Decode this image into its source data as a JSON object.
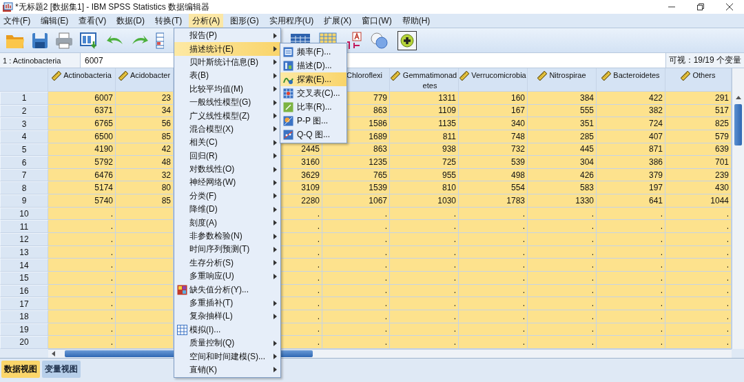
{
  "window": {
    "title": "*无标题2 [数据集1] - IBM SPSS Statistics 数据编辑器"
  },
  "menubar": [
    {
      "label": "文件(F)",
      "selected": false
    },
    {
      "label": "编辑(E)",
      "selected": false
    },
    {
      "label": "查看(V)",
      "selected": false
    },
    {
      "label": "数据(D)",
      "selected": false
    },
    {
      "label": "转换(T)",
      "selected": false
    },
    {
      "label": "分析(A)",
      "selected": true
    },
    {
      "label": "图形(G)",
      "selected": false
    },
    {
      "label": "实用程序(U)",
      "selected": false
    },
    {
      "label": "扩展(X)",
      "selected": false
    },
    {
      "label": "窗口(W)",
      "selected": false
    },
    {
      "label": "帮助(H)",
      "selected": false
    }
  ],
  "cell_editor": {
    "cell": "1 : Actinobacteria",
    "value": "6007",
    "visible_count": "可视：19/19 个变量"
  },
  "table": {
    "columns": [
      {
        "header": "Actinobacteria",
        "ruler": true
      },
      {
        "header": "Acidobacter",
        "ruler": true
      },
      null,
      {
        "header": "Chloroflexi"
      },
      {
        "header": "Gemmatimonadetes",
        "ruler": true
      },
      {
        "header": "Verrucomicrobia",
        "ruler": true
      },
      {
        "header": "Nitrospirae",
        "ruler": true
      },
      {
        "header": "Bacteroidetes",
        "ruler": true
      },
      {
        "header": "Others",
        "ruler": true
      }
    ],
    "rows": [
      {
        "number": "1",
        "cells": [
          "6007",
          "23",
          null,
          "779",
          "1311",
          "160",
          "384",
          "422",
          "291"
        ]
      },
      {
        "number": "2",
        "cells": [
          "6371",
          "34",
          null,
          "863",
          "1109",
          "167",
          "555",
          "382",
          "517"
        ]
      },
      {
        "number": "3",
        "cells": [
          "6765",
          "56",
          null,
          "1586",
          "1135",
          "340",
          "351",
          "724",
          "825"
        ]
      },
      {
        "number": "4",
        "cells": [
          "6500",
          "85",
          null,
          "1689",
          "811",
          "748",
          "285",
          "407",
          "579"
        ]
      },
      {
        "number": "5",
        "cells": [
          "4190",
          "42",
          "2445",
          "863",
          "938",
          "732",
          "445",
          "871",
          "639"
        ]
      },
      {
        "number": "6",
        "cells": [
          "5792",
          "48",
          "3160",
          "1235",
          "725",
          "539",
          "304",
          "386",
          "701"
        ]
      },
      {
        "number": "7",
        "cells": [
          "6476",
          "32",
          "3629",
          "765",
          "955",
          "498",
          "426",
          "379",
          "239"
        ]
      },
      {
        "number": "8",
        "cells": [
          "5174",
          "80",
          "3109",
          "1539",
          "810",
          "554",
          "583",
          "197",
          "430"
        ]
      },
      {
        "number": "9",
        "cells": [
          "5740",
          "85",
          "2280",
          "1067",
          "1030",
          "1783",
          "1330",
          "641",
          "1044"
        ]
      },
      {
        "number": "10",
        "cells": [
          ".",
          null,
          ".",
          ".",
          ".",
          ".",
          ".",
          ".",
          "."
        ]
      },
      {
        "number": "11",
        "cells": [
          ".",
          null,
          ".",
          ".",
          ".",
          ".",
          ".",
          ".",
          "."
        ]
      },
      {
        "number": "12",
        "cells": [
          ".",
          null,
          ".",
          ".",
          ".",
          ".",
          ".",
          ".",
          "."
        ]
      },
      {
        "number": "13",
        "cells": [
          ".",
          null,
          ".",
          ".",
          ".",
          ".",
          ".",
          ".",
          "."
        ]
      },
      {
        "number": "14",
        "cells": [
          ".",
          null,
          ".",
          ".",
          ".",
          ".",
          ".",
          ".",
          "."
        ]
      },
      {
        "number": "15",
        "cells": [
          ".",
          null,
          ".",
          ".",
          ".",
          ".",
          ".",
          ".",
          "."
        ]
      },
      {
        "number": "16",
        "cells": [
          ".",
          null,
          ".",
          ".",
          ".",
          ".",
          ".",
          ".",
          "."
        ]
      },
      {
        "number": "17",
        "cells": [
          ".",
          null,
          ".",
          ".",
          ".",
          ".",
          ".",
          ".",
          "."
        ]
      },
      {
        "number": "18",
        "cells": [
          ".",
          null,
          ".",
          ".",
          ".",
          ".",
          ".",
          ".",
          "."
        ]
      },
      {
        "number": "19",
        "cells": [
          ".",
          null,
          ".",
          ".",
          ".",
          ".",
          ".",
          ".",
          "."
        ]
      },
      {
        "number": "20",
        "cells": [
          ".",
          null,
          ".",
          ".",
          ".",
          ".",
          ".",
          ".",
          "."
        ]
      }
    ]
  },
  "analyze_menu": {
    "items": [
      {
        "label": "报告(P)",
        "kind": "submenu",
        "selected": false
      },
      {
        "label": "描述统计(E)",
        "kind": "submenu",
        "selected": true
      },
      {
        "label": "贝叶斯统计信息(B)",
        "kind": "submenu",
        "selected": false
      },
      {
        "label": "表(B)",
        "kind": "submenu",
        "selected": false
      },
      {
        "label": "比较平均值(M)",
        "kind": "submenu",
        "selected": false
      },
      {
        "label": "一般线性模型(G)",
        "kind": "submenu",
        "selected": false
      },
      {
        "label": "广义线性模型(Z)",
        "kind": "submenu",
        "selected": false
      },
      {
        "label": "混合模型(X)",
        "kind": "submenu",
        "selected": false
      },
      {
        "label": "相关(C)",
        "kind": "submenu",
        "selected": false
      },
      {
        "label": "回归(R)",
        "kind": "submenu",
        "selected": false
      },
      {
        "label": "对数线性(O)",
        "kind": "submenu",
        "selected": false
      },
      {
        "label": "神经网络(W)",
        "kind": "submenu",
        "selected": false
      },
      {
        "label": "分类(F)",
        "kind": "submenu",
        "selected": false
      },
      {
        "label": "降维(D)",
        "kind": "submenu",
        "selected": false
      },
      {
        "label": "刻度(A)",
        "kind": "submenu",
        "selected": false
      },
      {
        "label": "非参数检验(N)",
        "kind": "submenu",
        "selected": false
      },
      {
        "label": "时间序列预测(T)",
        "kind": "submenu",
        "selected": false
      },
      {
        "label": "生存分析(S)",
        "kind": "submenu",
        "selected": false
      },
      {
        "label": "多重响应(U)",
        "kind": "submenu",
        "selected": false
      },
      {
        "label": "缺失值分析(Y)...",
        "kind": "dialog",
        "selected": false
      },
      {
        "label": "多重插补(T)",
        "kind": "submenu",
        "selected": false
      },
      {
        "label": "复杂抽样(L)",
        "kind": "submenu",
        "selected": false
      },
      {
        "label": "模拟(I)...",
        "kind": "dialog",
        "selected": false
      },
      {
        "label": "质量控制(Q)",
        "kind": "submenu",
        "selected": false
      },
      {
        "label": "空间和时间建模(S)...",
        "kind": "submenu",
        "selected": false
      },
      {
        "label": "直销(K)",
        "kind": "submenu",
        "selected": false
      }
    ]
  },
  "descriptives_submenu": {
    "items": [
      {
        "label": "频率(F)...",
        "selected": false
      },
      {
        "label": "描述(D)...",
        "selected": false
      },
      {
        "label": "探索(E)...",
        "selected": true
      },
      {
        "label": "交叉表(C)...",
        "selected": false
      },
      {
        "label": "比率(R)...",
        "selected": false
      },
      {
        "label": "P-P 图...",
        "selected": false
      },
      {
        "label": "Q-Q 图...",
        "selected": false
      }
    ]
  },
  "view_tabs": [
    {
      "label": "数据视图",
      "selected": true
    },
    {
      "label": "变量视图",
      "selected": false
    }
  ]
}
